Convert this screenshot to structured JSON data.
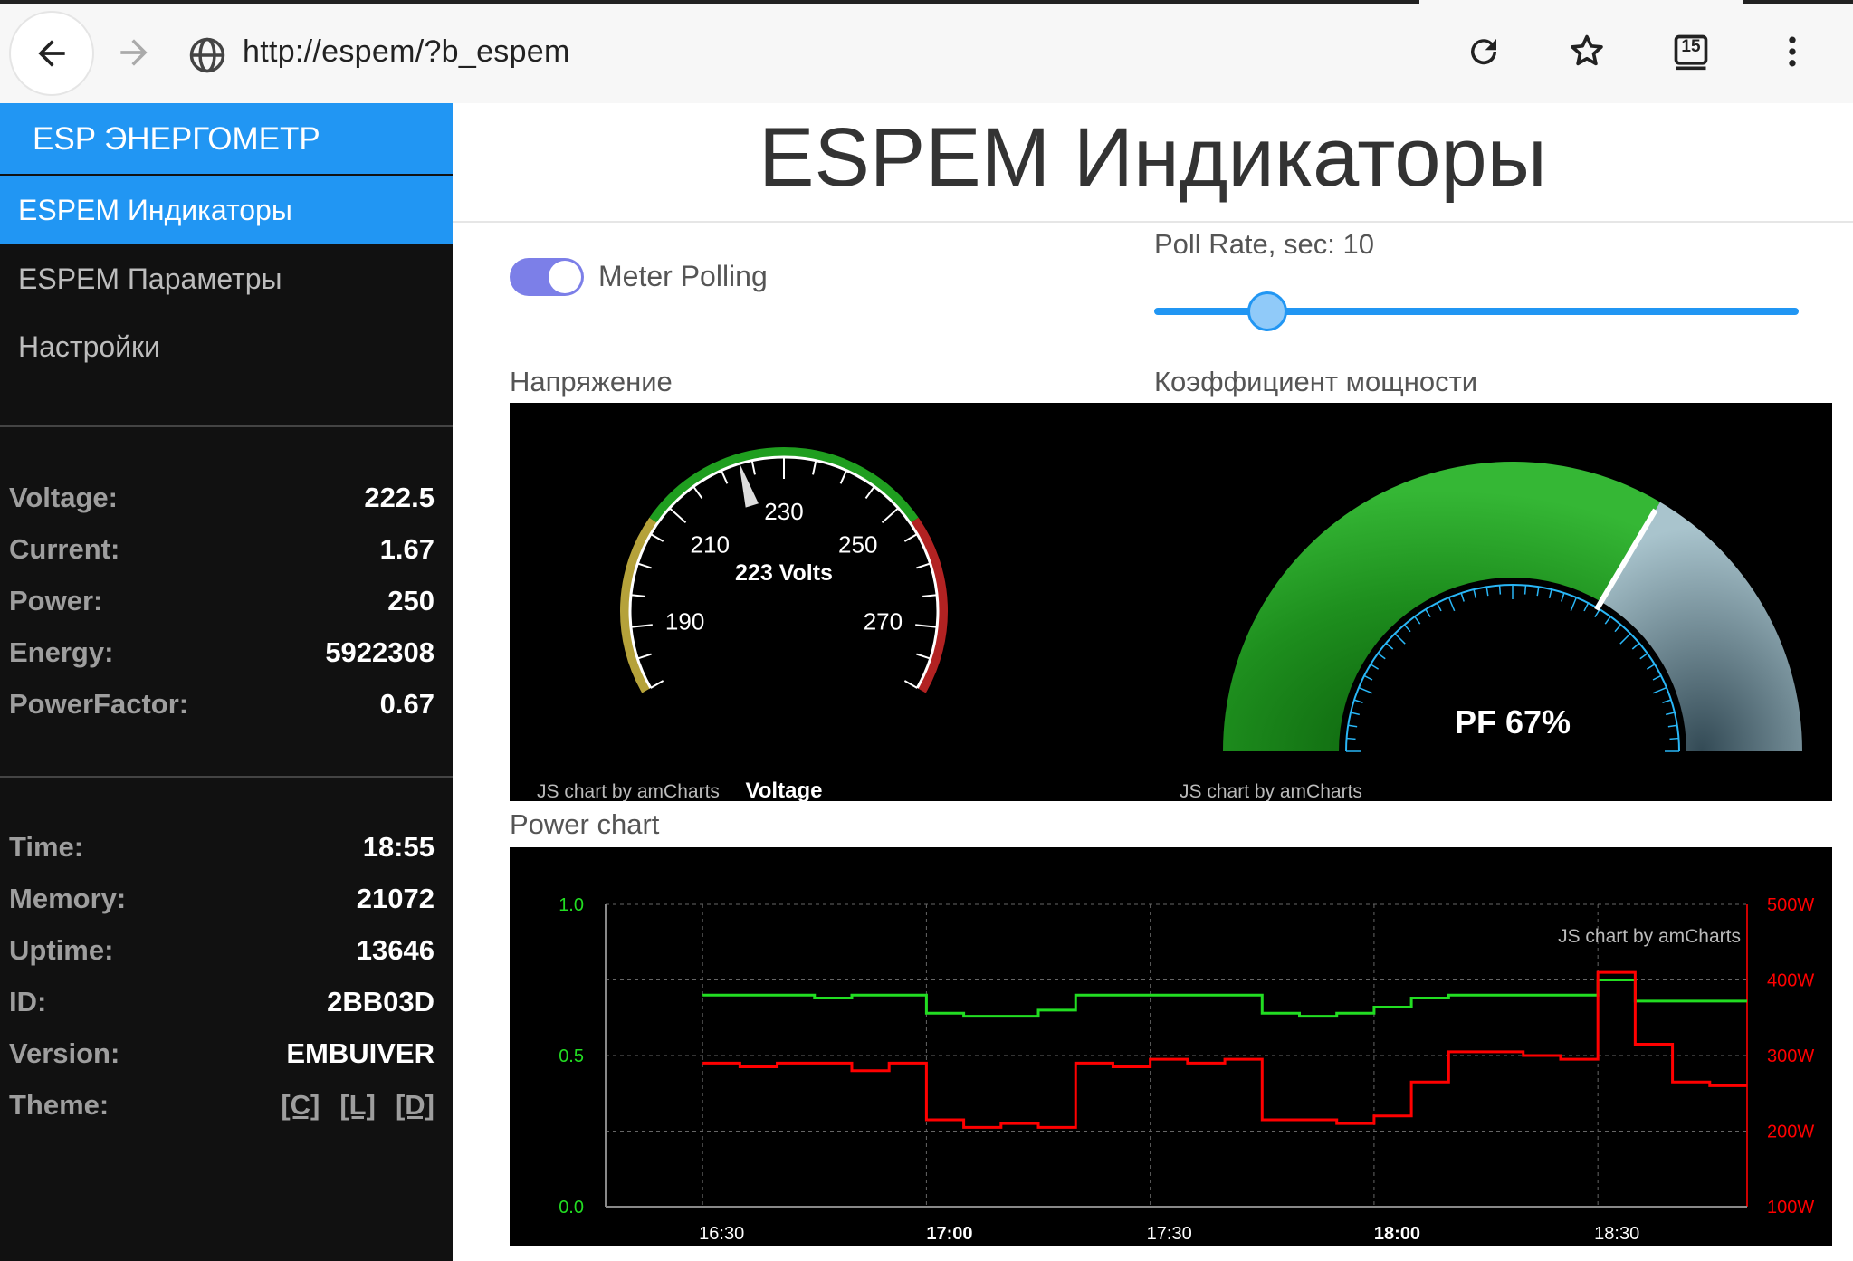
{
  "browser": {
    "url": "http://espem/?b_espem",
    "tab_count": "15",
    "icons": [
      "back-arrow-icon",
      "forward-arrow-icon",
      "globe-icon",
      "reload-icon",
      "star-icon",
      "tabs-icon",
      "more-vert-icon"
    ]
  },
  "sidebar": {
    "brand": "ESP ЭНЕРГОМЕТР",
    "nav": [
      {
        "label": "ESPEM Индикаторы",
        "active": true
      },
      {
        "label": "ESPEM Параметры",
        "active": false
      },
      {
        "label": "Настройки",
        "active": false
      }
    ],
    "meter_stats": [
      {
        "label": "Voltage:",
        "value": "222.5"
      },
      {
        "label": "Current:",
        "value": "1.67"
      },
      {
        "label": "Power:",
        "value": "250"
      },
      {
        "label": "Energy:",
        "value": "5922308"
      },
      {
        "label": "PowerFactor:",
        "value": "0.67"
      }
    ],
    "system_stats": [
      {
        "label": "Time:",
        "value": "18:55"
      },
      {
        "label": "Memory:",
        "value": "21072"
      },
      {
        "label": "Uptime:",
        "value": "13646"
      },
      {
        "label": "ID:",
        "value": "2BB03D"
      },
      {
        "label": "Version:",
        "value": "EMBUIVER"
      }
    ],
    "theme": {
      "label": "Theme:",
      "options": [
        "[C]",
        "[L]",
        "[D]"
      ]
    }
  },
  "main": {
    "title": "ESPEM Индикаторы",
    "polling": {
      "label": "Meter Polling",
      "enabled": true
    },
    "poll_rate": {
      "label": "Poll Rate, sec: 10",
      "value": 10,
      "min": 1,
      "max": 60
    },
    "voltage_section": "Напряжение",
    "pf_section": "Коэффициент мощности",
    "power_section": "Power chart",
    "credit": "JS chart by amCharts"
  },
  "colors": {
    "accent": "#2196f3",
    "sidebar_bg": "#111111",
    "green_series": "#22dd22",
    "red_series": "#ff0000",
    "gauge_green": "#1f9e1f",
    "gauge_yellow": "#b5a23a",
    "gauge_red": "#b22222"
  },
  "chart_data": [
    {
      "type": "gauge",
      "name": "voltage",
      "value": 223,
      "min": 180,
      "max": 280,
      "center_label": "223 Volts",
      "bottom_label": "Voltage",
      "tick_labels": [
        "190",
        "210",
        "230",
        "250",
        "270"
      ],
      "bands": [
        {
          "from": 180,
          "to": 207,
          "color": "#b5a23a"
        },
        {
          "from": 207,
          "to": 253,
          "color": "#1f9e1f"
        },
        {
          "from": 253,
          "to": 280,
          "color": "#b22222"
        }
      ]
    },
    {
      "type": "gauge",
      "name": "power_factor",
      "value": 67,
      "min": 0,
      "max": 100,
      "center_label": "PF 67%"
    },
    {
      "type": "line",
      "name": "power_chart",
      "x_ticks": [
        "16:30",
        "17:00",
        "17:30",
        "18:00",
        "18:30"
      ],
      "y_left": {
        "ticks": [
          "1.0",
          "0.5",
          "0.0"
        ],
        "range": [
          0,
          1
        ],
        "color": "#22dd22"
      },
      "y_right": {
        "ticks": [
          "500W",
          "400W",
          "300W",
          "200W",
          "100W"
        ],
        "range": [
          100,
          500
        ],
        "color": "#ff0000"
      },
      "grid": true,
      "x": [
        "16:30",
        "16:35",
        "16:40",
        "16:45",
        "16:50",
        "16:55",
        "17:00",
        "17:05",
        "17:10",
        "17:15",
        "17:20",
        "17:25",
        "17:30",
        "17:35",
        "17:40",
        "17:45",
        "17:50",
        "17:55",
        "18:00",
        "18:05",
        "18:10",
        "18:15",
        "18:20",
        "18:25",
        "18:30",
        "18:35",
        "18:40",
        "18:45"
      ],
      "series": [
        {
          "values": [
            0.7,
            0.7,
            0.7,
            0.69,
            0.7,
            0.7,
            0.64,
            0.63,
            0.63,
            0.65,
            0.7,
            0.7,
            0.7,
            0.7,
            0.7,
            0.64,
            0.63,
            0.64,
            0.66,
            0.69,
            0.7,
            0.7,
            0.7,
            0.7,
            0.75,
            0.68,
            0.68,
            0.68
          ]
        },
        {
          "values": [
            290,
            285,
            290,
            290,
            280,
            290,
            215,
            205,
            210,
            205,
            290,
            285,
            295,
            290,
            295,
            215,
            215,
            210,
            220,
            265,
            305,
            305,
            300,
            295,
            410,
            315,
            265,
            260
          ]
        }
      ]
    }
  ]
}
